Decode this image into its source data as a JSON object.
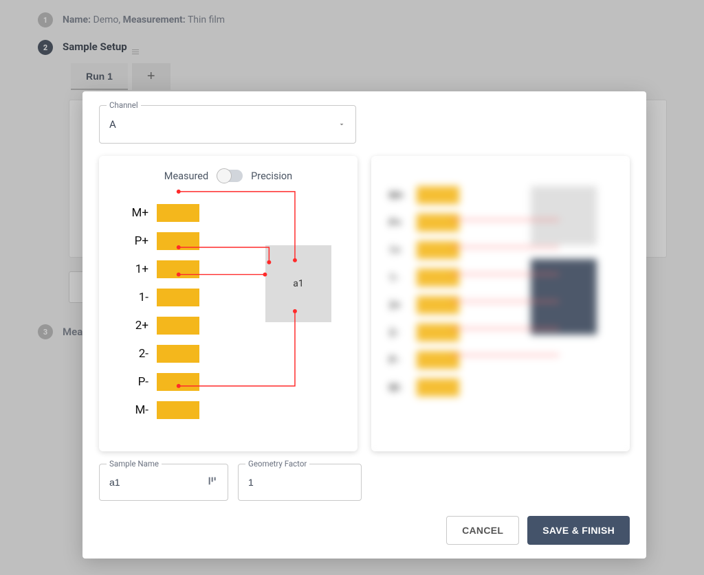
{
  "step1": {
    "num": "1",
    "name_label": "Name:",
    "name_value": "Demo,",
    "measurement_label": "Measurement:",
    "measurement_value": "Thin film"
  },
  "step2": {
    "num": "2",
    "title": "Sample Setup",
    "tabs": {
      "run1": "Run 1",
      "add": "+"
    }
  },
  "step3": {
    "num": "3",
    "title_partial": "Mea"
  },
  "modal": {
    "channel_label": "Channel",
    "channel_value": "A",
    "toggle": {
      "left": "Measured",
      "right": "Precision"
    },
    "probes": [
      "M+",
      "P+",
      "1+",
      "1-",
      "2+",
      "2-",
      "P-",
      "M-"
    ],
    "sample_chip": "a1",
    "blur_probes": [
      "M+",
      "P+",
      "1+",
      "1-",
      "2+",
      "2-",
      "P-",
      "M-"
    ],
    "sample_name_label": "Sample Name",
    "sample_name_value": "a1",
    "geometry_label": "Geometry Factor",
    "geometry_value": "1",
    "cancel": "CANCEL",
    "save": "SAVE & FINISH"
  }
}
